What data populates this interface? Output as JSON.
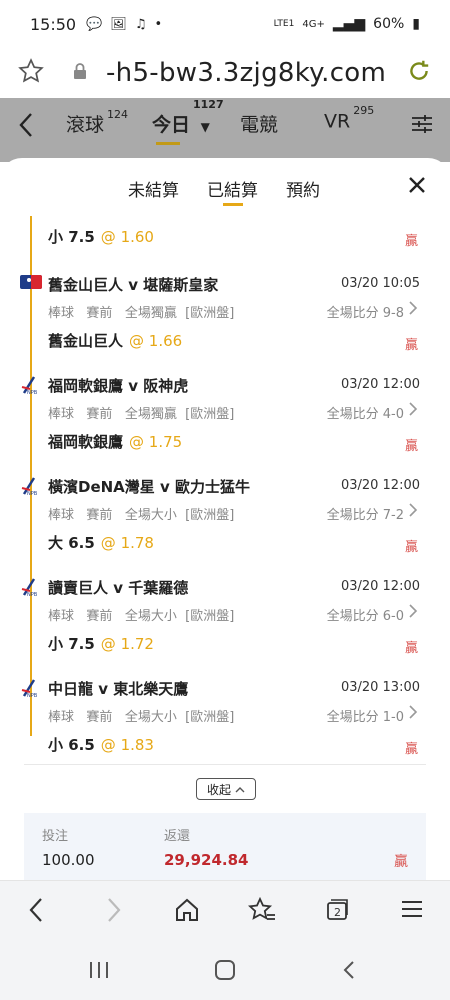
{
  "status_bar": {
    "time": "15:50",
    "signal": "4G+",
    "volte": "LTE1",
    "battery": "60%"
  },
  "browser": {
    "url": "-h5-bw3.3zjg8ky.com"
  },
  "header": {
    "tabs": [
      {
        "label": "滾球",
        "count": "124"
      },
      {
        "label": "今日",
        "count": "1127"
      },
      {
        "label": "電競",
        "count": ""
      },
      {
        "label": "VR",
        "count": "295"
      }
    ]
  },
  "sheet": {
    "tabs": [
      {
        "label": "未結算"
      },
      {
        "label": "已結算"
      },
      {
        "label": "預約"
      }
    ],
    "partial_bet": {
      "pick": "小 7.5",
      "odds": "@ 1.60",
      "result": "贏"
    },
    "bets": [
      {
        "title": "舊金山巨人 v 堪薩斯皇家",
        "datetime": "03/20 10:05",
        "sport": "棒球",
        "stage": "賽前",
        "market": "全場獨贏",
        "odds_type": "[歐洲盤]",
        "score": "全場比分 9-8",
        "pick": "舊金山巨人",
        "odds": "@ 1.66",
        "result": "贏"
      },
      {
        "title": "福岡軟銀鷹 v 阪神虎",
        "datetime": "03/20 12:00",
        "sport": "棒球",
        "stage": "賽前",
        "market": "全場獨贏",
        "odds_type": "[歐洲盤]",
        "score": "全場比分 4-0",
        "pick": "福岡軟銀鷹",
        "odds": "@ 1.75",
        "result": "贏"
      },
      {
        "title": "橫濱DeNA灣星 v 歐力士猛牛",
        "datetime": "03/20 12:00",
        "sport": "棒球",
        "stage": "賽前",
        "market": "全場大小",
        "odds_type": "[歐洲盤]",
        "score": "全場比分 7-2",
        "pick": "大 6.5",
        "odds": "@ 1.78",
        "result": "贏"
      },
      {
        "title": "讀賣巨人 v 千葉羅德",
        "datetime": "03/20 12:00",
        "sport": "棒球",
        "stage": "賽前",
        "market": "全場大小",
        "odds_type": "[歐洲盤]",
        "score": "全場比分 6-0",
        "pick": "小 7.5",
        "odds": "@ 1.72",
        "result": "贏"
      },
      {
        "title": "中日龍 v 東北樂天鷹",
        "datetime": "03/20 13:00",
        "sport": "棒球",
        "stage": "賽前",
        "market": "全場大小",
        "odds_type": "[歐洲盤]",
        "score": "全場比分 1-0",
        "pick": "小 6.5",
        "odds": "@ 1.83",
        "result": "贏"
      }
    ],
    "collapse_label": "收起",
    "summary": {
      "stake_label": "投注",
      "stake_value": "100.00",
      "return_label": "返還",
      "return_value": "29,924.84",
      "result": "贏"
    }
  },
  "colors": {
    "accent": "#e6a817",
    "win": "#d9534f",
    "dim_header": "#aaaaaa"
  }
}
